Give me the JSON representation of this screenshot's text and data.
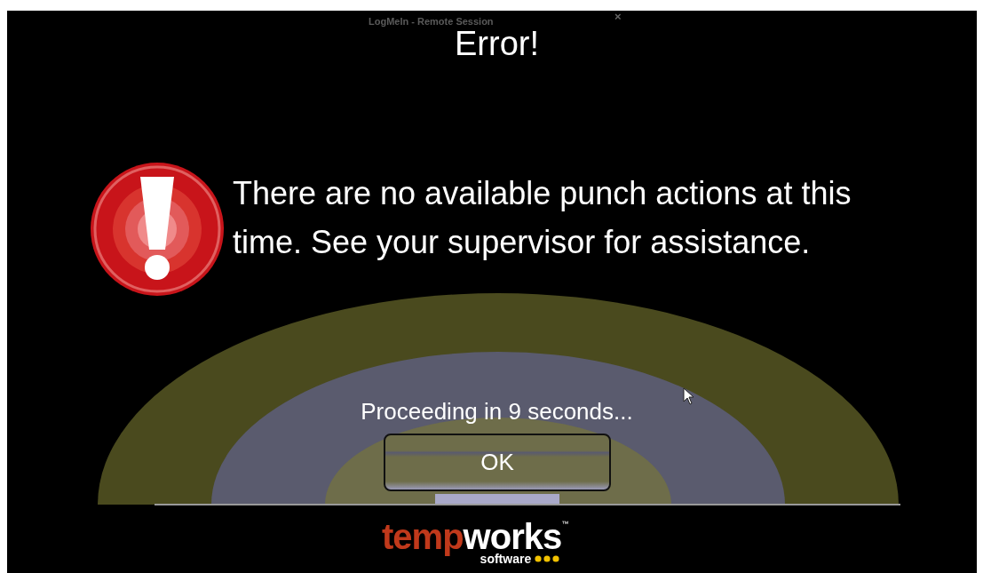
{
  "session_bar": {
    "title": "LogMeIn - Remote Session",
    "close": "×"
  },
  "dialog": {
    "title": "Error!",
    "message": "There are no available punch actions at this time. See your supervisor for assistance.",
    "countdown": "Proceeding in 9 seconds...",
    "button": "OK"
  },
  "logo": {
    "part_1": "temp",
    "part_2": "works",
    "trademark": "™",
    "tagline": "software"
  }
}
